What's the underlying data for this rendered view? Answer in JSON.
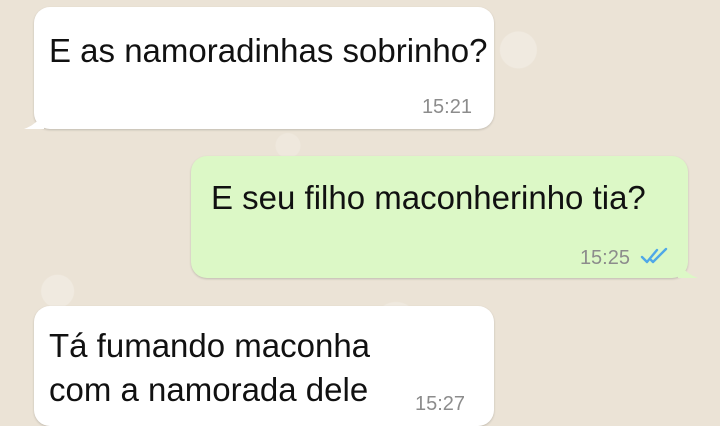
{
  "messages": [
    {
      "direction": "incoming",
      "lines": [
        "E as namoradinhas",
        "sobrinho?"
      ],
      "time": "15:21"
    },
    {
      "direction": "outgoing",
      "lines": [
        "E seu filho maconherinho",
        "tia?"
      ],
      "time": "15:25",
      "status_icon": "double-check-read-icon"
    },
    {
      "direction": "incoming",
      "lines": [
        "Tá fumando maconha",
        "com a namorada dele"
      ],
      "time": "15:27"
    }
  ],
  "colors": {
    "background": "#ebe3d6",
    "incoming_bubble": "#ffffff",
    "outgoing_bubble": "#dcf8c6",
    "read_check": "#4fa8e8",
    "timestamp": "#8c8c8c"
  }
}
